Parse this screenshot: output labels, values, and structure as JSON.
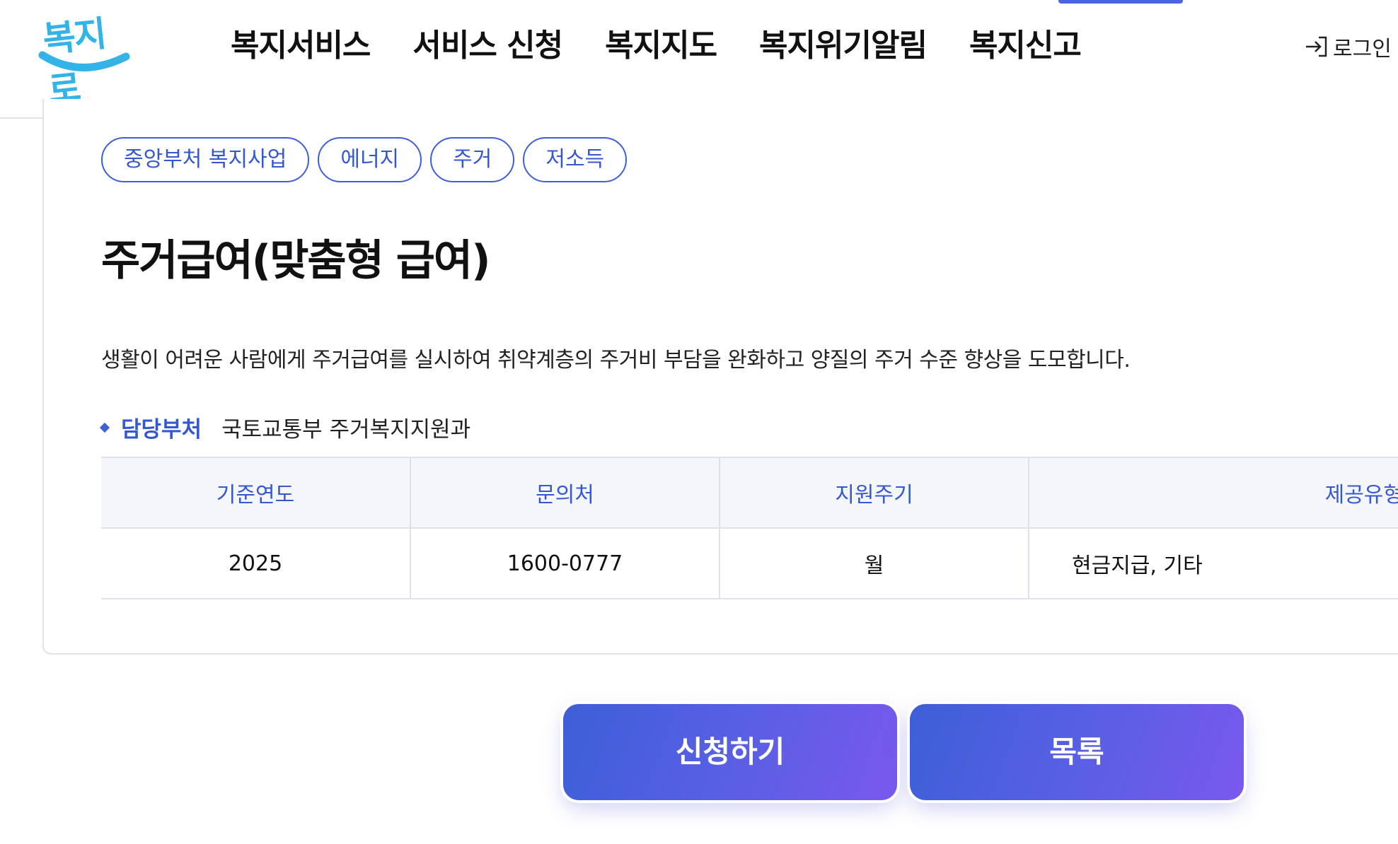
{
  "header": {
    "logo_text": "복지로",
    "nav": [
      {
        "label": "복지서비스"
      },
      {
        "label": "서비스 신청"
      },
      {
        "label": "복지지도"
      },
      {
        "label": "복지위기알림"
      },
      {
        "label": "복지신고"
      }
    ],
    "login_label": "로그인",
    "login_icon": "login-arrow-icon"
  },
  "service": {
    "tags": [
      "중앙부처 복지사업",
      "에너지",
      "주거",
      "저소득"
    ],
    "title": "주거급여(맞춤형 급여)",
    "description": "생활이 어려운 사람에게 주거급여를 실시하여 취약계층의 주거비 부담을 완화하고 양질의 주거 수준 향상을 도모합니다.",
    "department_label": "담당부처",
    "department_value": "국토교통부 주거복지지원과"
  },
  "table": {
    "headers": [
      "기준연도",
      "문의처",
      "지원주기",
      "제공유형"
    ],
    "row": [
      "2025",
      "1600-0777",
      "월",
      "현금지급, 기타"
    ]
  },
  "buttons": {
    "apply_label": "신청하기",
    "list_label": "목록"
  },
  "colors": {
    "accent": "#3557d0",
    "logo": "#33b3e6",
    "button_gradient_start": "#3d5fd8",
    "button_gradient_end": "#7a58ee"
  }
}
